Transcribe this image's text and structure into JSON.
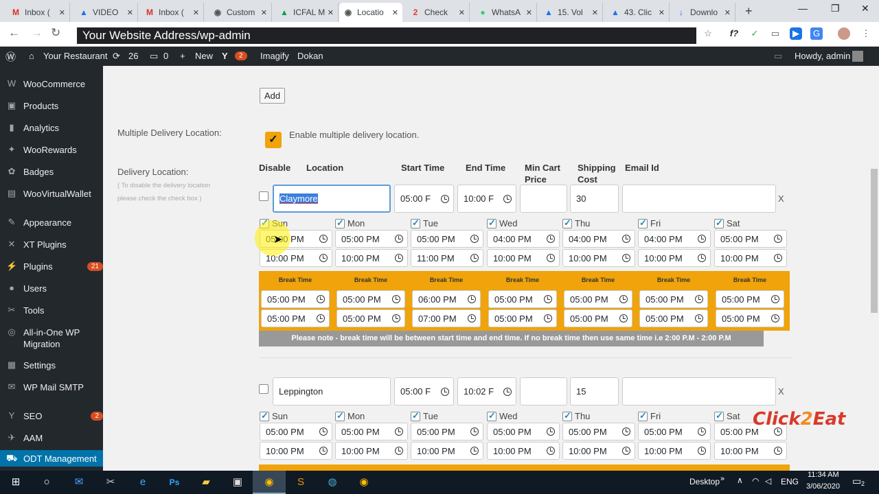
{
  "browser": {
    "tabs": [
      {
        "icon": "M",
        "label": "Inbox (",
        "color": "#d93025"
      },
      {
        "icon": "▲",
        "label": "VIDEO",
        "color": "#1a73e8"
      },
      {
        "icon": "M",
        "label": "Inbox (",
        "color": "#d93025"
      },
      {
        "icon": "◉",
        "label": "Custom",
        "color": "#555"
      },
      {
        "icon": "▲",
        "label": "ICFAL M",
        "color": "#0f9d58"
      },
      {
        "icon": "◉",
        "label": "Locatio",
        "color": "#555"
      },
      {
        "icon": "2",
        "label": "Check",
        "color": "#e53935"
      },
      {
        "icon": "●",
        "label": "WhatsA",
        "color": "#25d366"
      },
      {
        "icon": "▲",
        "label": "15. Vol",
        "color": "#1a73e8"
      },
      {
        "icon": "▲",
        "label": "43. Clic",
        "color": "#1a73e8"
      },
      {
        "icon": "↓",
        "label": "Downlo",
        "color": "#1a73e8"
      }
    ],
    "url": "Your Website Address/wp-admin"
  },
  "adminbar": {
    "site": "Your Restaurant",
    "updates": "26",
    "comments": "0",
    "new": "New",
    "yoast": "2",
    "imagify": "Imagify",
    "dokan": "Dokan",
    "howdy": "Howdy, admin"
  },
  "sidebar": [
    {
      "icon": "W",
      "label": "WooCommerce"
    },
    {
      "icon": "▣",
      "label": "Products"
    },
    {
      "icon": "▮",
      "label": "Analytics"
    },
    {
      "icon": "✦",
      "label": "WooRewards"
    },
    {
      "icon": "✿",
      "label": "Badges"
    },
    {
      "icon": "▤",
      "label": "WooVirtualWallet"
    },
    {
      "icon": "✎",
      "label": "Appearance"
    },
    {
      "icon": "✕",
      "label": "XT Plugins"
    },
    {
      "icon": "⚡",
      "label": "Plugins",
      "badge": "21"
    },
    {
      "icon": "●",
      "label": "Users"
    },
    {
      "icon": "✂",
      "label": "Tools"
    },
    {
      "icon": "◎",
      "label": "All-in-One WP Migration"
    },
    {
      "icon": "▦",
      "label": "Settings"
    },
    {
      "icon": "✉",
      "label": "WP Mail SMTP"
    },
    {
      "icon": "Y",
      "label": "SEO",
      "badge": "2"
    },
    {
      "icon": "✈",
      "label": "AAM"
    },
    {
      "icon": "⛟",
      "label": "ODT Management"
    }
  ],
  "form": {
    "add_label": "Add",
    "multi_label": "Multiple Delivery Location:",
    "multi_check_label": "Enable multiple delivery location.",
    "delivery_label": "Delivery Location:",
    "delivery_hint": "( To disable the delivery location please check the check box )",
    "headers": {
      "disable": "Disable",
      "location": "Location",
      "start": "Start Time",
      "end": "End Time",
      "min": "Min Cart Price",
      "ship": "Shipping Cost",
      "email": "Email Id"
    },
    "break_label": "Break Time",
    "note": "Please note - break time will be between start time and end time. If no break time then use same time i.e 2:00 P.M - 2:00 P.M",
    "delete": "X",
    "locations": [
      {
        "name": "Claymore",
        "start": "05:00 F",
        "end": "10:00 F",
        "min": "",
        "ship": "30",
        "email": "",
        "days": [
          {
            "day": "Sun",
            "open": "05:00 PM",
            "close": "10:00 PM",
            "b1": "05:00 PM",
            "b2": "05:00 PM"
          },
          {
            "day": "Mon",
            "open": "05:00 PM",
            "close": "10:00 PM",
            "b1": "05:00 PM",
            "b2": "05:00 PM"
          },
          {
            "day": "Tue",
            "open": "05:00 PM",
            "close": "11:00 PM",
            "b1": "06:00 PM",
            "b2": "07:00 PM"
          },
          {
            "day": "Wed",
            "open": "04:00 PM",
            "close": "10:00 PM",
            "b1": "05:00 PM",
            "b2": "05:00 PM"
          },
          {
            "day": "Thu",
            "open": "04:00 PM",
            "close": "10:00 PM",
            "b1": "05:00 PM",
            "b2": "05:00 PM"
          },
          {
            "day": "Fri",
            "open": "04:00 PM",
            "close": "10:00 PM",
            "b1": "05:00 PM",
            "b2": "05:00 PM"
          },
          {
            "day": "Sat",
            "open": "05:00 PM",
            "close": "10:00 PM",
            "b1": "05:00 PM",
            "b2": "05:00 PM"
          }
        ]
      },
      {
        "name": "Leppington",
        "start": "05:00 F",
        "end": "10:02 F",
        "min": "",
        "ship": "15",
        "email": "",
        "days": [
          {
            "day": "Sun",
            "open": "05:00 PM",
            "close": "10:00 PM"
          },
          {
            "day": "Mon",
            "open": "05:00 PM",
            "close": "10:00 PM"
          },
          {
            "day": "Tue",
            "open": "05:00 PM",
            "close": "10:00 PM"
          },
          {
            "day": "Wed",
            "open": "05:00 PM",
            "close": "10:00 PM"
          },
          {
            "day": "Thu",
            "open": "05:00 PM",
            "close": "10:00 PM"
          },
          {
            "day": "Fri",
            "open": "05:00 PM",
            "close": "10:00 PM"
          },
          {
            "day": "Sat",
            "open": "05:00 PM",
            "close": "10:00 PM"
          }
        ]
      }
    ]
  },
  "logo": {
    "a": "Click",
    "b": "2",
    "c": "Eat"
  },
  "taskbar": {
    "desktop": "Desktop",
    "lang": "ENG",
    "time": "11:34 AM",
    "date": "3/06/2020",
    "notif": "2"
  }
}
